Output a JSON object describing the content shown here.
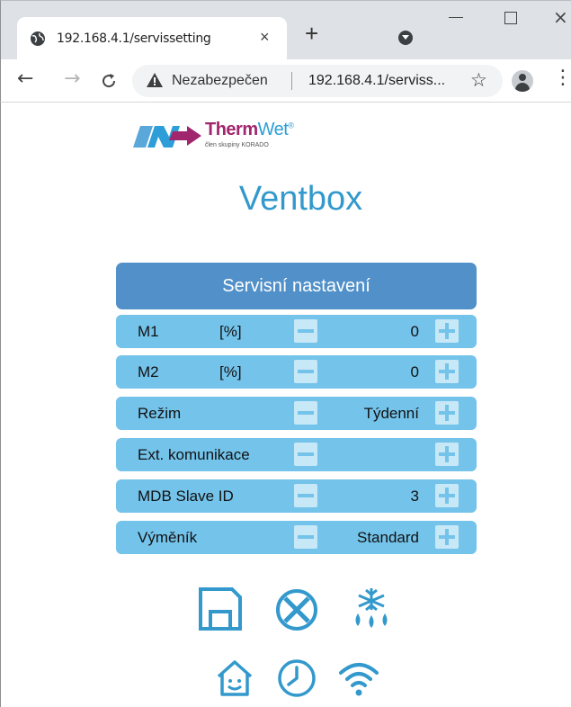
{
  "browser": {
    "tab_title": "192.168.4.1/servissetting",
    "tab_close": "×",
    "new_tab": "+",
    "insecure_label": "Nezabezpečen",
    "url": "192.168.4.1/serviss...",
    "star": "☆",
    "window_close": "×"
  },
  "page": {
    "logo": {
      "brand_first": "Therm",
      "brand_second": "Wet",
      "registered": "®",
      "tagline": "člen skupiny KORADO"
    },
    "title": "Ventbox",
    "panel_title": "Servisní nastavení",
    "rows": [
      {
        "label": "M1",
        "unit": "[%]",
        "value": "0"
      },
      {
        "label": "M2",
        "unit": "[%]",
        "value": "0"
      },
      {
        "label": "Režim",
        "unit": "",
        "value": "Týdenní"
      },
      {
        "label": "Ext. komunikace",
        "unit": "",
        "value": ""
      },
      {
        "label": "MDB Slave ID",
        "unit": "",
        "value": "3"
      },
      {
        "label": "Výměník",
        "unit": "",
        "value": "Standard"
      }
    ],
    "actions": [
      "save-icon",
      "cancel-icon",
      "defrost-icon",
      "home-icon",
      "clock-icon",
      "wifi-icon"
    ]
  },
  "colors": {
    "accent": "#3399cc",
    "panel_header": "#5190c8",
    "row_background": "#74c3ea",
    "button_background": "#c7e8f7",
    "brand_magenta": "#a0266e"
  }
}
